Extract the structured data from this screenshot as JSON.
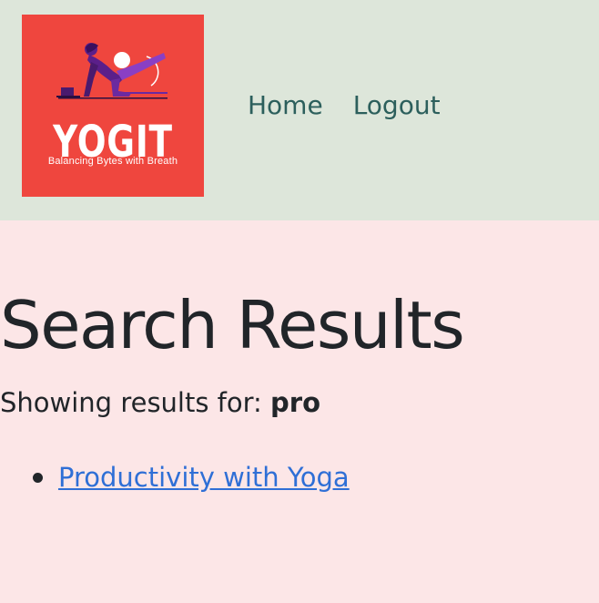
{
  "header": {
    "logo": {
      "title": "YOGIT",
      "tagline": "Balancing Bytes with Breath",
      "background": "#ef463e"
    },
    "nav": {
      "home_label": "Home",
      "logout_label": "Logout"
    },
    "background": "#dde6da"
  },
  "main": {
    "title": "Search Results",
    "showing_prefix": "Showing results for:",
    "query": "pro",
    "results": [
      {
        "label": "Productivity with Yoga"
      }
    ],
    "background": "#fce6e7",
    "link_color": "#2f6fd6"
  }
}
